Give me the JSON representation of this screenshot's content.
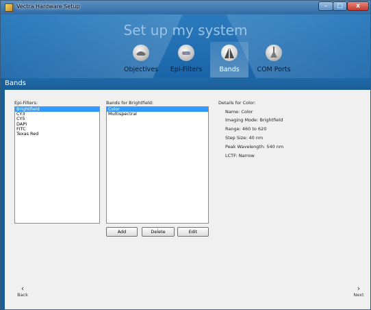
{
  "window": {
    "title": "Vectra Hardware Setup",
    "minimize": "–",
    "maximize": "□",
    "close": "x"
  },
  "header": {
    "page_title": "Set up my system",
    "tabs": [
      {
        "label": "Objectives",
        "icon": "objective-icon",
        "active": false
      },
      {
        "label": "Epi-Filters",
        "icon": "filter-icon",
        "active": false
      },
      {
        "label": "Bands",
        "icon": "bands-icon",
        "active": true
      },
      {
        "label": "COM Ports",
        "icon": "com-port-icon",
        "active": false
      }
    ]
  },
  "section": {
    "title": "Bands"
  },
  "epi_filters": {
    "label": "Epi-Filters:",
    "items": [
      "Brightfield",
      "CY3",
      "CY5",
      "DAPI",
      "FITC",
      "Texas Red"
    ],
    "selected": "Brightfield"
  },
  "bands": {
    "label": "Bands for Brightfield:",
    "items": [
      "Color",
      "Multispectral"
    ],
    "selected": "Color",
    "add_label": "Add",
    "delete_label": "Delete",
    "edit_label": "Edit"
  },
  "details": {
    "heading": "Details for Color:",
    "lines": [
      "Name: Color",
      "Imaging Mode: Brightfield",
      "Range: 460 to 620",
      "Step Size: 40 nm",
      "Peak Wavelength: 540 nm",
      "LCTF: Narrow"
    ]
  },
  "footer": {
    "back_label": "Back",
    "next_label": "Next",
    "back_chevron": "‹",
    "next_chevron": "›"
  },
  "colors": {
    "header_blue": "#2a7bbd",
    "selection": "#3399ff",
    "title_light": "#9fc3e6"
  }
}
